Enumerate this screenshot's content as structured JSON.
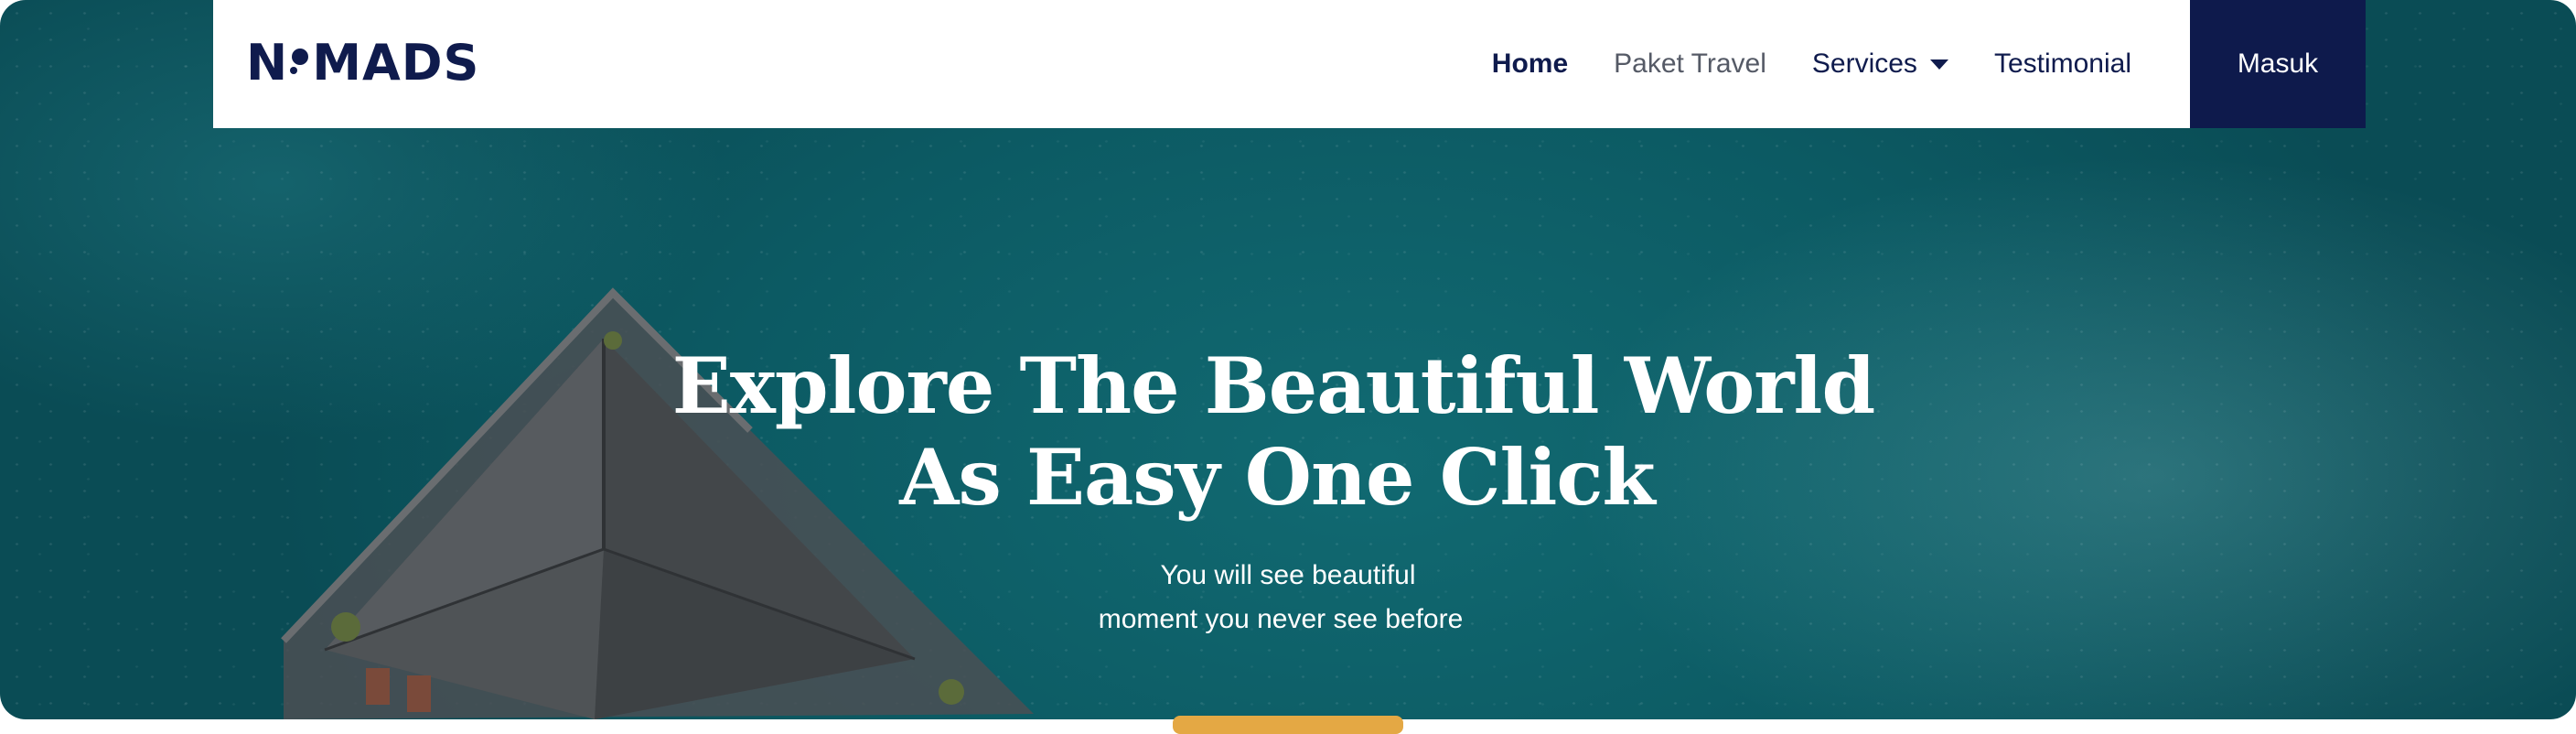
{
  "brand": {
    "logo_text_n": "N",
    "logo_text_rest": "MADS"
  },
  "nav": {
    "home": "Home",
    "paket_travel": "Paket Travel",
    "services": "Services",
    "testimonial": "Testimonial",
    "login": "Masuk"
  },
  "hero": {
    "title_line1": "Explore The Beautiful World",
    "title_line2": "As Easy One Click",
    "subtitle_line1": "You will see beautiful",
    "subtitle_line2": "moment you never see before"
  },
  "colors": {
    "navy": "#0e1a4c",
    "sea": "#0c5a63",
    "accent": "#e4a844"
  },
  "icons": {
    "services_dropdown": "caret-down-icon",
    "logo_mark": "location-pin-icon"
  }
}
